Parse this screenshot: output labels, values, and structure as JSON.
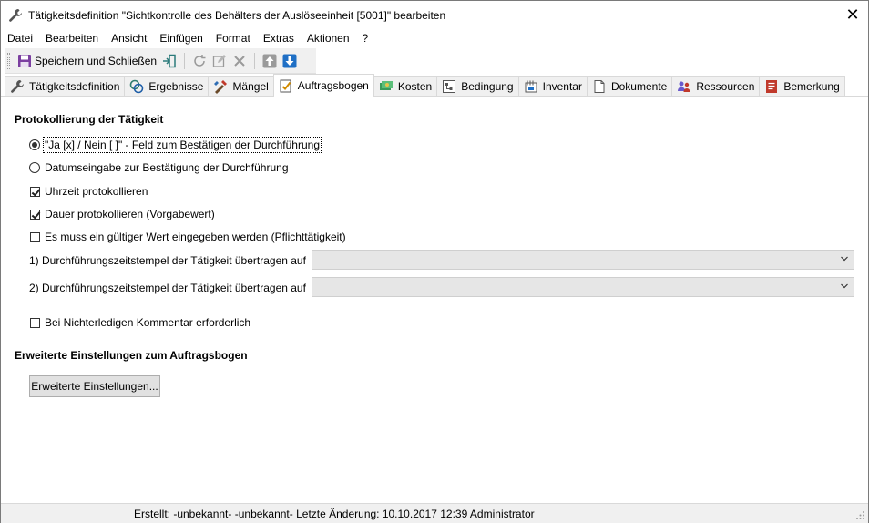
{
  "window": {
    "title": "Tätigkeitsdefinition \"Sichtkontrolle des Behälters der Auslöseeinheit [5001]\" bearbeiten",
    "icon": "wrench-icon",
    "close_symbol": "✕"
  },
  "menu": [
    "Datei",
    "Bearbeiten",
    "Ansicht",
    "Einfügen",
    "Format",
    "Extras",
    "Aktionen",
    "?"
  ],
  "toolbar": {
    "save_close_label": "Speichern und Schließen"
  },
  "tabs": [
    {
      "label": "Tätigkeitsdefinition",
      "icon": "wrench-icon"
    },
    {
      "label": "Ergebnisse",
      "icon": "results-icon"
    },
    {
      "label": "Mängel",
      "icon": "defects-icon"
    },
    {
      "label": "Auftragsbogen",
      "icon": "order-sheet-icon",
      "active": true
    },
    {
      "label": "Kosten",
      "icon": "costs-icon"
    },
    {
      "label": "Bedingung",
      "icon": "condition-icon"
    },
    {
      "label": "Inventar",
      "icon": "inventory-icon"
    },
    {
      "label": "Dokumente",
      "icon": "document-icon"
    },
    {
      "label": "Ressourcen",
      "icon": "resources-icon"
    },
    {
      "label": "Bemerkung",
      "icon": "note-icon"
    }
  ],
  "protocol": {
    "title": "Protokollierung der Tätigkeit",
    "radio_yes_no": "\"Ja [x] / Nein [ ]\" - Feld zum Bestätigen der Durchführung",
    "radio_date": "Datumseingabe zur Bestätigung der Durchführung",
    "chk_time": "Uhrzeit protokollieren",
    "chk_duration": "Dauer protokollieren (Vorgabewert)",
    "chk_mandatory": "Es muss ein gültiger Wert eingegeben werden (Pflichttätigkeit)",
    "combo1_label": "1) Durchführungszeitstempel der Tätigkeit übertragen auf",
    "combo1_value": "",
    "combo2_label": "2) Durchführungszeitstempel der Tätigkeit übertragen auf",
    "combo2_value": "",
    "chk_comment": "Bei Nichterledigen Kommentar erforderlich",
    "selected_radio": "yes_no",
    "chk_time_checked": true,
    "chk_duration_checked": true,
    "chk_mandatory_checked": false,
    "chk_comment_checked": false
  },
  "advanced": {
    "title": "Erweiterte Einstellungen zum Auftragsbogen",
    "button": "Erweiterte Einstellungen..."
  },
  "status": {
    "text": "Erstellt: -unbekannt- -unbekannt-  Letzte Änderung: 10.10.2017 12:39 Administrator"
  }
}
